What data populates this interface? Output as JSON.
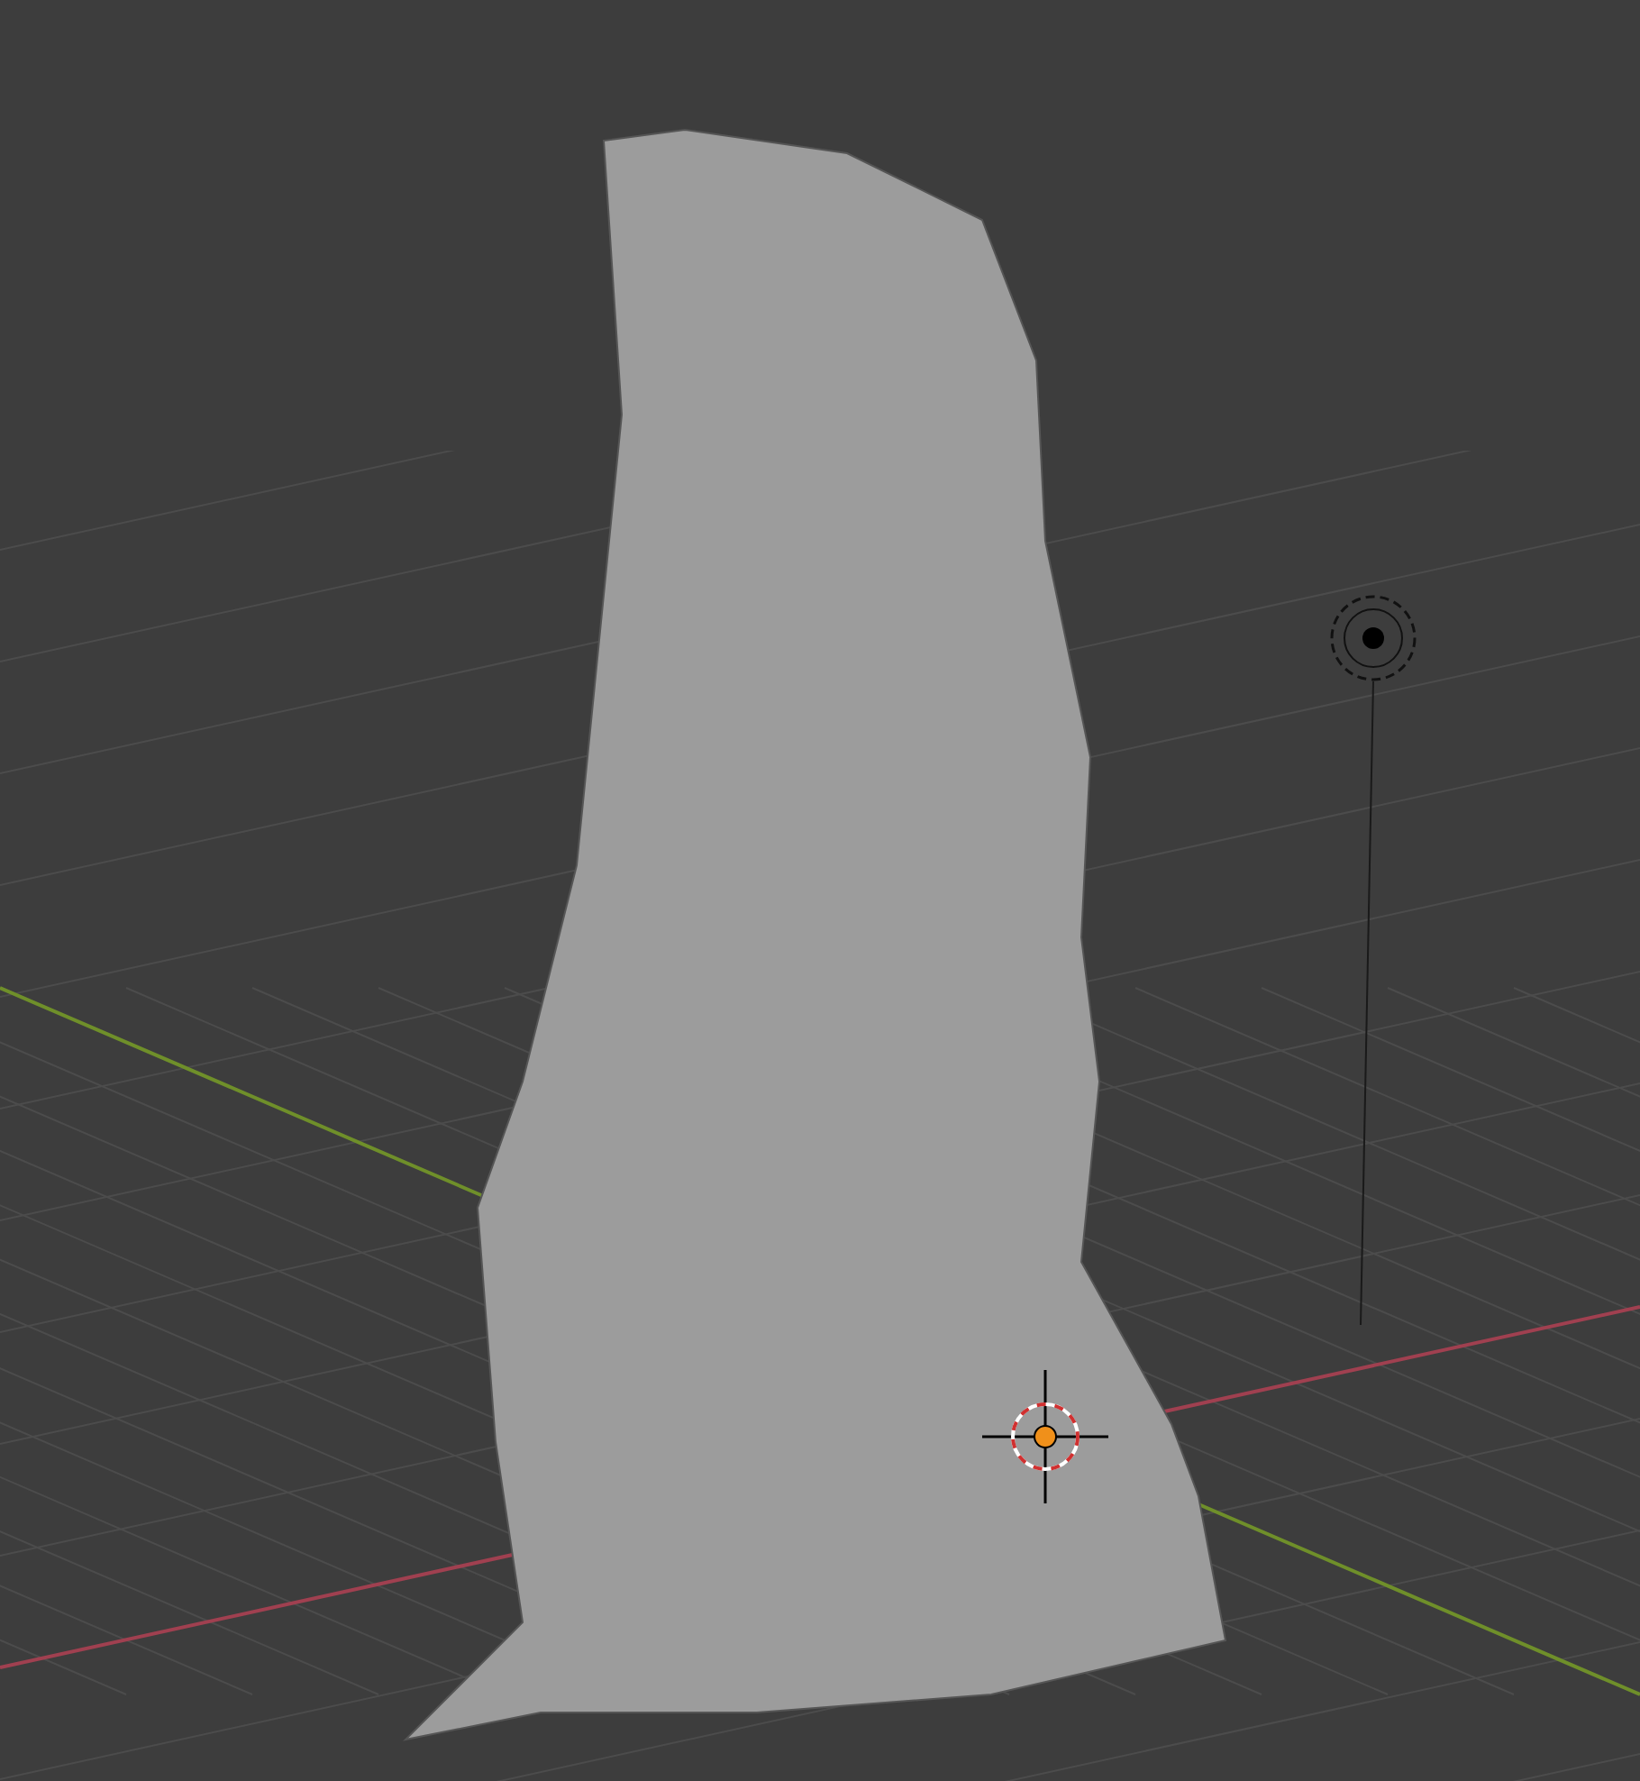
{
  "viewport": {
    "objects": [
      {
        "kind": "grid"
      },
      {
        "kind": "x_axis"
      },
      {
        "kind": "y_axis"
      },
      {
        "kind": "mesh"
      },
      {
        "kind": "light"
      },
      {
        "kind": "cursor"
      }
    ]
  }
}
